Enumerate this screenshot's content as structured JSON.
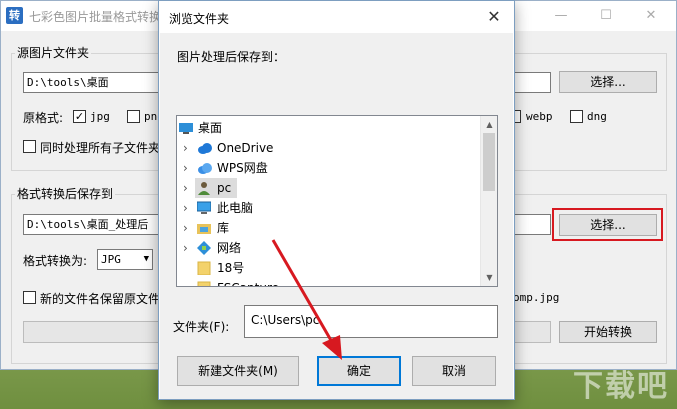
{
  "main_window": {
    "title": "七彩色图片批量格式转换",
    "source_group_label": "源图片文件夹",
    "source_path": "D:\\tools\\桌面",
    "source_select_button": "选择...",
    "original_format_label": "原格式:",
    "formats": [
      {
        "name": "jpg",
        "checked": true
      },
      {
        "name": "png",
        "checked": false
      },
      {
        "name": "webp",
        "checked": false
      },
      {
        "name": "dng",
        "checked": false
      }
    ],
    "subfolder_option": "同时处理所有子文件夹",
    "dest_group_label": "格式转换后保存到",
    "dest_path": "D:\\tools\\桌面_处理后",
    "dest_select_button": "选择...",
    "convert_to_label": "格式转换为:",
    "convert_to_value": "JPG",
    "keep_name_option": "新的文件名保留原文件",
    "sample_filename": "omp.jpg",
    "start_button": "开始转换"
  },
  "dialog": {
    "title": "浏览文件夹",
    "prompt": "图片处理后保存到：",
    "tree_items": [
      {
        "label": "桌面",
        "icon": "desktop-icon",
        "expandable": false,
        "selected": false
      },
      {
        "label": "OneDrive",
        "icon": "cloud-icon",
        "expandable": true,
        "selected": false
      },
      {
        "label": "WPS网盘",
        "icon": "cloud-icon",
        "expandable": true,
        "selected": false
      },
      {
        "label": "pc",
        "icon": "user-icon",
        "expandable": true,
        "selected": true
      },
      {
        "label": "此电脑",
        "icon": "computer-icon",
        "expandable": true,
        "selected": false
      },
      {
        "label": "库",
        "icon": "library-icon",
        "expandable": true,
        "selected": false
      },
      {
        "label": "网络",
        "icon": "network-icon",
        "expandable": true,
        "selected": false
      },
      {
        "label": "18号",
        "icon": "folder-icon",
        "expandable": false,
        "selected": false
      },
      {
        "label": "FSCapture",
        "icon": "folder-icon",
        "expandable": false,
        "selected": false
      }
    ],
    "folder_label": "文件夹(F):",
    "folder_value": "C:\\Users\\pc",
    "new_folder_button": "新建文件夹(M)",
    "ok_button": "确定",
    "cancel_button": "取消"
  },
  "watermark": "下载吧",
  "colors": {
    "highlight": "#d71920",
    "arrow": "#d71920",
    "primary_border": "#0078d7"
  }
}
